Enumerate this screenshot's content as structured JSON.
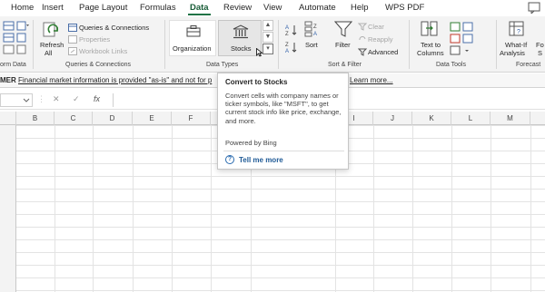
{
  "tabs": [
    {
      "label": "Home",
      "active": false
    },
    {
      "label": "Insert",
      "active": false
    },
    {
      "label": "Page Layout",
      "active": false
    },
    {
      "label": "Formulas",
      "active": false
    },
    {
      "label": "Data",
      "active": true
    },
    {
      "label": "Review",
      "active": false
    },
    {
      "label": "View",
      "active": false
    },
    {
      "label": "Automate",
      "active": false
    },
    {
      "label": "Help",
      "active": false
    },
    {
      "label": "WPS PDF",
      "active": false
    }
  ],
  "ribbon": {
    "get_data_group_label": "orm Data",
    "refresh_all_label": "Refresh",
    "refresh_all_label2": "All",
    "queries_connections_label": "Queries & Connections",
    "properties_label": "Properties",
    "workbook_links_label": "Workbook Links",
    "queries_group_label": "Queries & Connections",
    "organization_label": "Organization",
    "stocks_label": "Stocks",
    "data_types_group_label": "Data Types",
    "sort_label": "Sort",
    "filter_label": "Filter",
    "clear_label": "Clear",
    "reapply_label": "Reapply",
    "advanced_label": "Advanced",
    "sort_filter_group_label": "Sort & Filter",
    "text_to_columns_label": "Text to",
    "text_to_columns_label2": "Columns",
    "data_tools_group_label": "Data Tools",
    "what_if_label": "What-If",
    "what_if_label2": "Analysis",
    "forecast_label": "Fo",
    "forecast_label2": "S",
    "forecast_group_label": "Forecast"
  },
  "infobar": {
    "heading": "MER",
    "message": "Financial market information is provided \"as-is\" and not for p",
    "learn_more": "Learn more..."
  },
  "formula_bar": {
    "cancel_symbol": "✕",
    "enter_symbol": "✓",
    "fx_symbol": "fx"
  },
  "columns": [
    "B",
    "C",
    "D",
    "E",
    "F",
    "G",
    "H",
    "I",
    "J",
    "K",
    "L",
    "M"
  ],
  "tooltip": {
    "title": "Convert to Stocks",
    "body": "Convert cells with company names or ticker symbols, like \"MSFT\", to get current stock info like price, exchange, and more.",
    "powered_by": "Powered by Bing",
    "help_symbol": "?",
    "tell_me_more": "Tell me more"
  },
  "colors": {
    "accent_green": "#217346",
    "active_tab_text": "#185c37",
    "link_blue": "#1f5a96"
  }
}
